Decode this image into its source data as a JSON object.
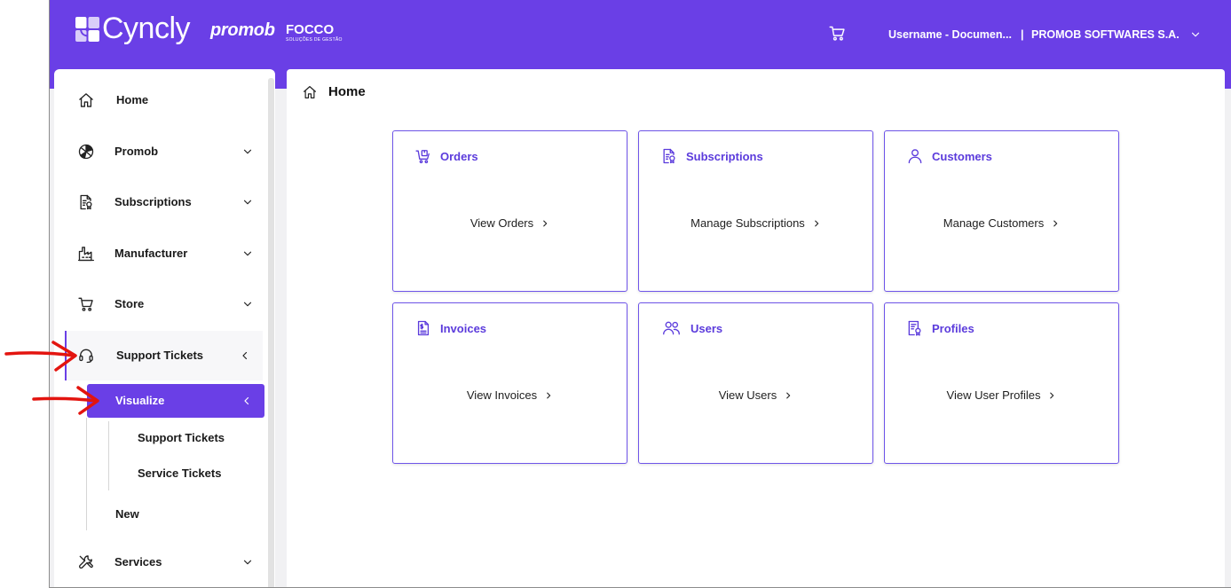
{
  "colors": {
    "primary": "#6a3fe6",
    "card_title": "#5b3bdc",
    "card_border": "#6f55e9",
    "background": "#f1f1f3",
    "annotation": "#e3140f"
  },
  "header": {
    "logo_icon": "cyncly-logo-icon",
    "brand": "Cyncly",
    "brand2": "promob",
    "brand3": "FOCCO",
    "brand3_sub": "SOLUÇÕES DE GESTÃO",
    "cart_icon": "cart-icon",
    "user": "Username - Documen...",
    "separator": "|",
    "company": "PROMOB SOFTWARES S.A.",
    "menu_icon": "chevron-down-icon"
  },
  "sidebar": {
    "items": [
      {
        "label": "Home",
        "icon": "home-icon"
      },
      {
        "label": "Promob",
        "icon": "aperture-icon",
        "chevron": "chevron-down-icon"
      },
      {
        "label": "Subscriptions",
        "icon": "subscription-document-icon",
        "chevron": "chevron-down-icon"
      },
      {
        "label": "Manufacturer",
        "icon": "factory-icon",
        "chevron": "chevron-down-icon"
      },
      {
        "label": "Store",
        "icon": "cart-icon",
        "chevron": "chevron-down-icon"
      },
      {
        "label": "Support Tickets",
        "icon": "headset-icon",
        "chevron": "chevron-left-icon",
        "active": true
      },
      {
        "label": "Services",
        "icon": "tools-icon",
        "chevron": "chevron-down-icon"
      }
    ],
    "submenu": {
      "label": "Visualize",
      "chevron": "chevron-left-icon",
      "items": [
        "Support Tickets",
        "Service Tickets"
      ]
    },
    "new_label": "New"
  },
  "breadcrumb": {
    "label": "Home",
    "icon": "home-icon"
  },
  "cards": [
    {
      "title": "Orders",
      "icon": "orders-cart-icon",
      "link": "View Orders"
    },
    {
      "title": "Subscriptions",
      "icon": "subscription-document-icon",
      "link": "Manage Subscriptions"
    },
    {
      "title": "Customers",
      "icon": "person-icon",
      "link": "Manage Customers"
    },
    {
      "title": "Invoices",
      "icon": "invoice-icon",
      "link": "View Invoices"
    },
    {
      "title": "Users",
      "icon": "users-icon",
      "link": "View Users"
    },
    {
      "title": "Profiles",
      "icon": "profile-id-icon",
      "link": "View User Profiles"
    }
  ]
}
